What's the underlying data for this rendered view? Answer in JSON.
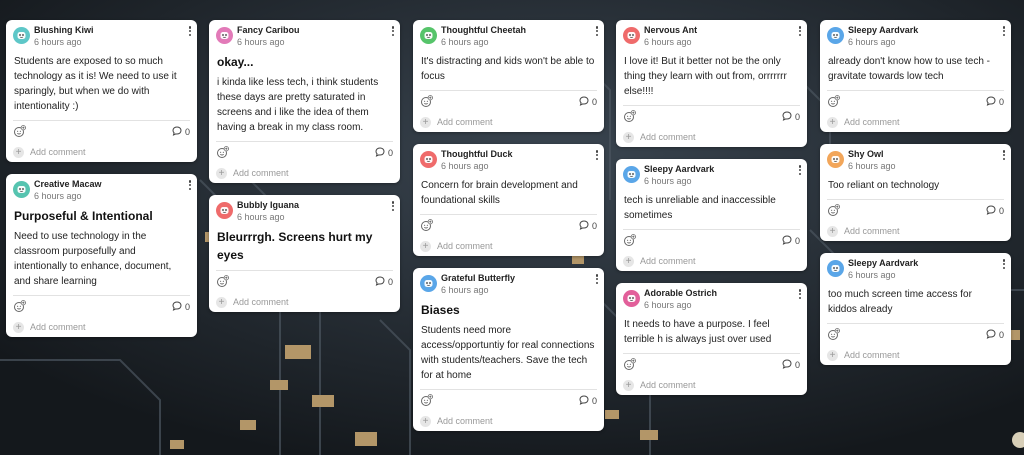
{
  "theme": {
    "card_bg": "#ffffff",
    "background": "#20262c",
    "chip_gold": "#b39668"
  },
  "add_comment_label": "Add comment",
  "columns": [
    [
      {
        "author": "Blushing Kiwi",
        "time": "6 hours ago",
        "avatar_color": "#5ec7c8",
        "avatar_icon": "kiwi-avatar-icon",
        "subject": "",
        "body": "Students are exposed to so much technology as it is! We need to use it sparingly, but when we do with intentionality :)",
        "big": false,
        "comments": "0"
      },
      {
        "author": "Creative Macaw",
        "time": "6 hours ago",
        "avatar_color": "#56c4b0",
        "avatar_icon": "macaw-avatar-icon",
        "subject": "Purposeful & Intentional",
        "body": "Need to use technology in the classroom purposefully and intentionally to enhance, document, and share learning",
        "big": false,
        "comments": "0"
      }
    ],
    [
      {
        "author": "Fancy Caribou",
        "time": "6 hours ago",
        "avatar_color": "#e27ab8",
        "avatar_icon": "caribou-avatar-icon",
        "subject": "okay...",
        "body": "i kinda like less tech, i think students these days are pretty saturated in screens and i like the idea of them having a break in my class room.",
        "big": false,
        "comments": "0"
      },
      {
        "author": "Bubbly Iguana",
        "time": "6 hours ago",
        "avatar_color": "#ef6b6b",
        "avatar_icon": "iguana-avatar-icon",
        "subject": "",
        "body": "Bleurrrgh. Screens hurt my eyes",
        "big": true,
        "comments": "0"
      }
    ],
    [
      {
        "author": "Thoughtful Cheetah",
        "time": "6 hours ago",
        "avatar_color": "#56c46a",
        "avatar_icon": "cheetah-avatar-icon",
        "subject": "",
        "body": "It's distracting and kids won't be able to focus",
        "big": false,
        "comments": "0"
      },
      {
        "author": "Thoughtful Duck",
        "time": "6 hours ago",
        "avatar_color": "#ef6b6b",
        "avatar_icon": "duck-avatar-icon",
        "subject": "",
        "body": "Concern for brain development and foundational skills",
        "big": false,
        "comments": "0"
      },
      {
        "author": "Grateful Butterfly",
        "time": "6 hours ago",
        "avatar_color": "#5aa6e8",
        "avatar_icon": "butterfly-avatar-icon",
        "subject": "Biases",
        "body": "Students need more access/opportuntiy for real connections with students/teachers. Save the tech for at home",
        "big": false,
        "comments": "0"
      }
    ],
    [
      {
        "author": "Nervous Ant",
        "time": "6 hours ago",
        "avatar_color": "#ef6b6b",
        "avatar_icon": "ant-avatar-icon",
        "subject": "",
        "body": "I love it! But it better not be the only thing they learn with out from, orrrrrrr else!!!!",
        "big": false,
        "comments": "0"
      },
      {
        "author": "Sleepy Aardvark",
        "time": "6 hours ago",
        "avatar_color": "#5aa6e8",
        "avatar_icon": "aardvark-avatar-icon",
        "subject": "",
        "body": "tech is unreliable and inaccessible sometimes",
        "big": false,
        "comments": "0"
      },
      {
        "author": "Adorable Ostrich",
        "time": "6 hours ago",
        "avatar_color": "#e25f9a",
        "avatar_icon": "ostrich-avatar-icon",
        "subject": "",
        "body": "It needs to have a purpose. I feel terrible h is always just over used",
        "big": false,
        "comments": "0"
      }
    ],
    [
      {
        "author": "Sleepy Aardvark",
        "time": "6 hours ago",
        "avatar_color": "#5aa6e8",
        "avatar_icon": "aardvark-avatar-icon",
        "subject": "",
        "body": "already don't know how to use tech - gravitate towards low tech",
        "big": false,
        "comments": "0"
      },
      {
        "author": "Shy Owl",
        "time": "6 hours ago",
        "avatar_color": "#f2a65a",
        "avatar_icon": "owl-avatar-icon",
        "subject": "",
        "body": "Too reliant on technology",
        "big": false,
        "comments": "0"
      },
      {
        "author": "Sleepy Aardvark",
        "time": "6 hours ago",
        "avatar_color": "#5aa6e8",
        "avatar_icon": "aardvark-avatar-icon",
        "subject": "",
        "body": "too much screen time access for kiddos already",
        "big": false,
        "comments": "0"
      }
    ]
  ]
}
